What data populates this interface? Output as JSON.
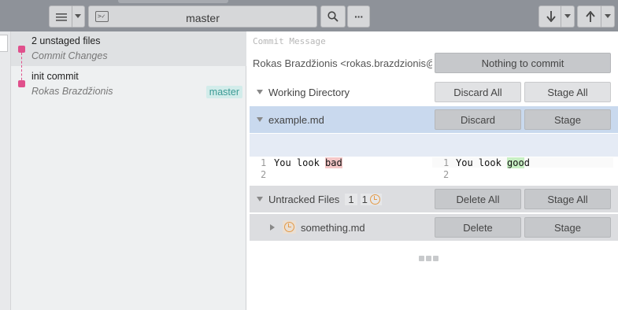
{
  "toolbar": {
    "branch_name": "master",
    "more_label": "···"
  },
  "commits": [
    {
      "title": "2 unstaged files",
      "subtitle": "Commit Changes"
    },
    {
      "title": "init commit",
      "subtitle": "Rokas Brazdžionis",
      "branch": "master"
    }
  ],
  "commit_panel": {
    "message_placeholder": "Commit Message",
    "author": "Rokas Brazdžionis <rokas.brazdzionis@gmail.com>",
    "commit_button": "Nothing to commit"
  },
  "working_directory": {
    "label": "Working Directory",
    "discard_all": "Discard All",
    "stage_all": "Stage All"
  },
  "file": {
    "name": "example.md",
    "discard": "Discard",
    "stage": "Stage"
  },
  "diff": {
    "left": [
      {
        "n": "1",
        "pre": "You look ",
        "hl": "bad",
        "post": ""
      },
      {
        "n": "2",
        "pre": "",
        "hl": "",
        "post": ""
      }
    ],
    "right": [
      {
        "n": "1",
        "pre": "You look ",
        "hl": "goo",
        "post": "d"
      },
      {
        "n": "2",
        "pre": "",
        "hl": "",
        "post": ""
      }
    ]
  },
  "untracked": {
    "label": "Untracked Files",
    "count1": "1",
    "count2": "1",
    "delete_all": "Delete All",
    "stage_all": "Stage All",
    "file_name": "something.md",
    "delete": "Delete",
    "stage": "Stage"
  },
  "colors": {
    "toolbar_bg": "#8e9299",
    "graph": "#e0508c",
    "branch_tag_bg": "#d2ecea",
    "file_row_bg": "#c9d9ee",
    "untracked_clock": "#e39a48"
  },
  "icons": [
    "menu-icon",
    "terminal-icon",
    "search-icon",
    "more-icon",
    "pull-icon",
    "push-icon",
    "chevron-down-icon",
    "clock-icon"
  ]
}
